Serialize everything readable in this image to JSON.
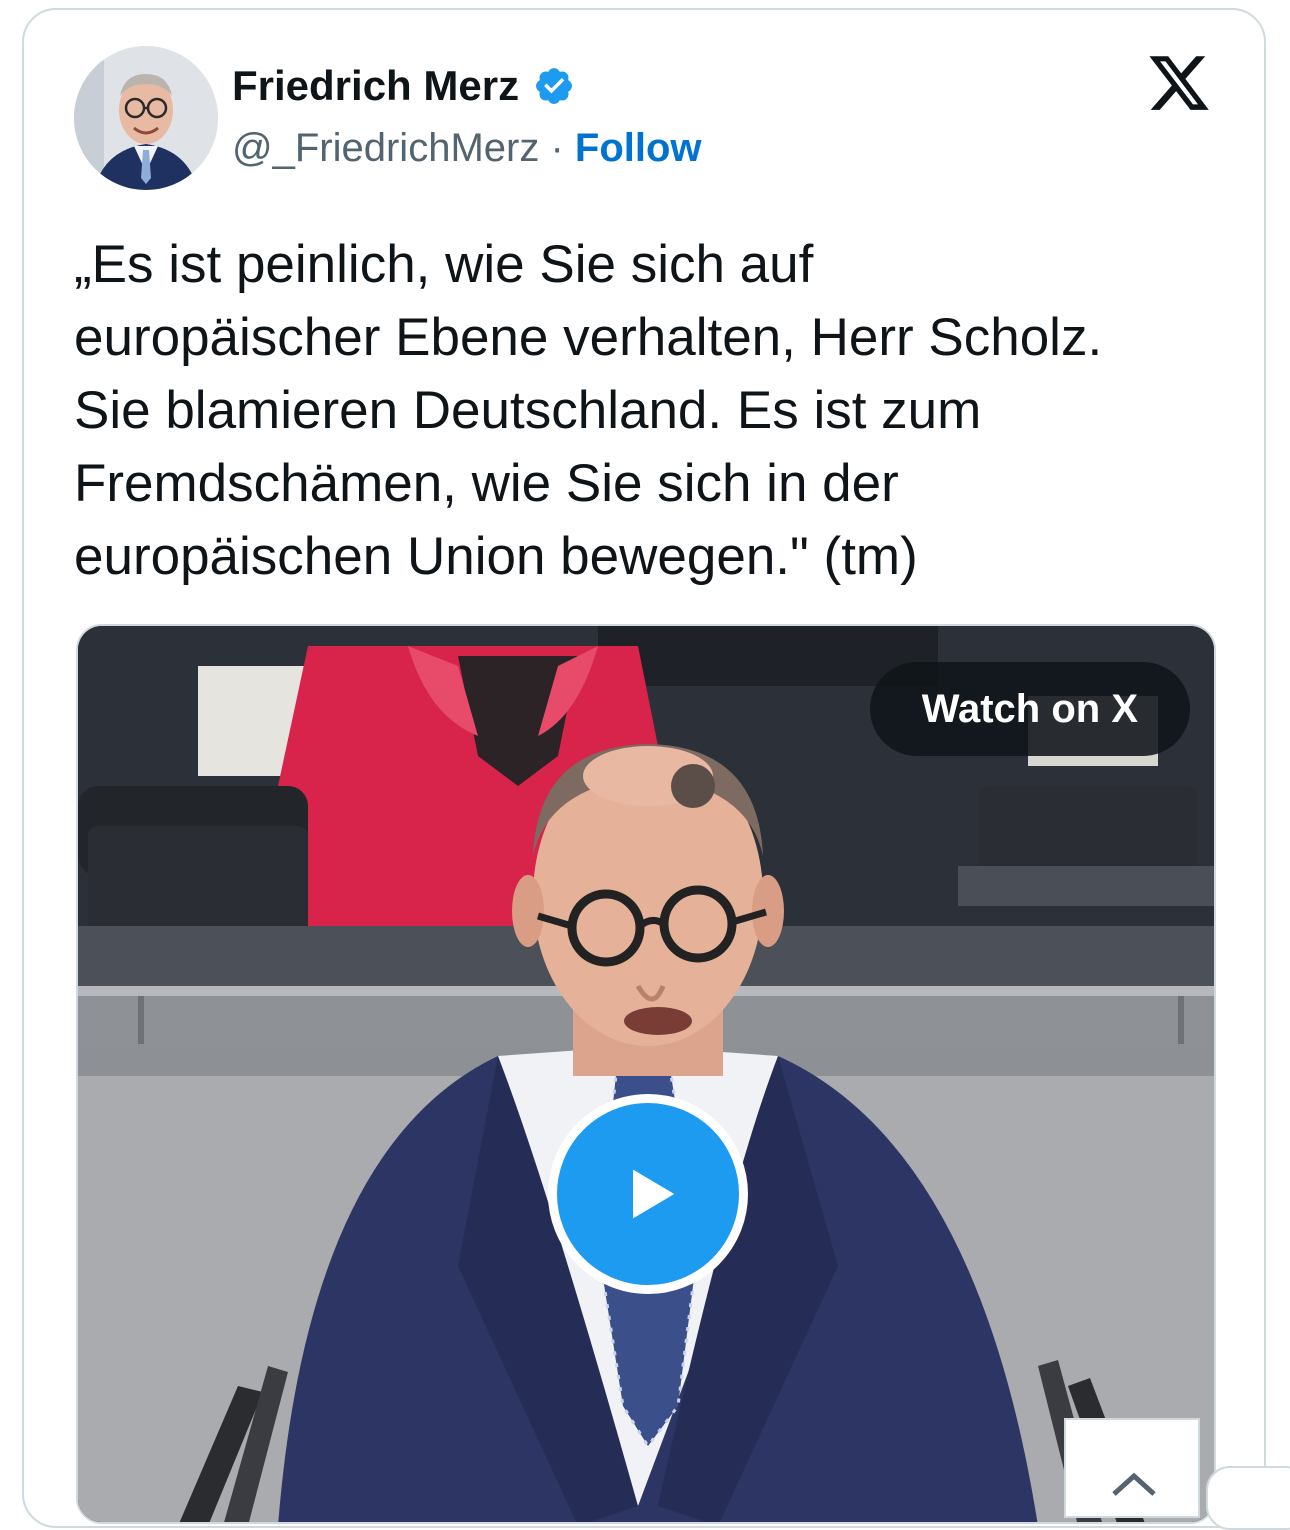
{
  "author": {
    "display_name": "Friedrich Merz",
    "handle": "@_FriedrichMerz",
    "separator": "·",
    "follow_label": "Follow",
    "verified": true
  },
  "tweet": {
    "text": "„Es ist peinlich, wie Sie sich auf\neuropäischer Ebene verhalten, Herr Scholz.\nSie blamieren Deutschland. Es ist zum\nFremdschämen, wie Sie sich in der\neuropäischen Union bewegen.\" (tm)"
  },
  "media": {
    "type": "video",
    "watch_label": "Watch on X"
  },
  "icons": {
    "verified": "verified-badge-icon",
    "brand": "x-logo-icon",
    "play": "play-icon",
    "scroll": "chevron-up-icon"
  },
  "colors": {
    "accent": "#1d9bf0",
    "follow": "#0073d1",
    "text": "#0f1419",
    "muted": "#536471",
    "border": "#cfd9de"
  }
}
